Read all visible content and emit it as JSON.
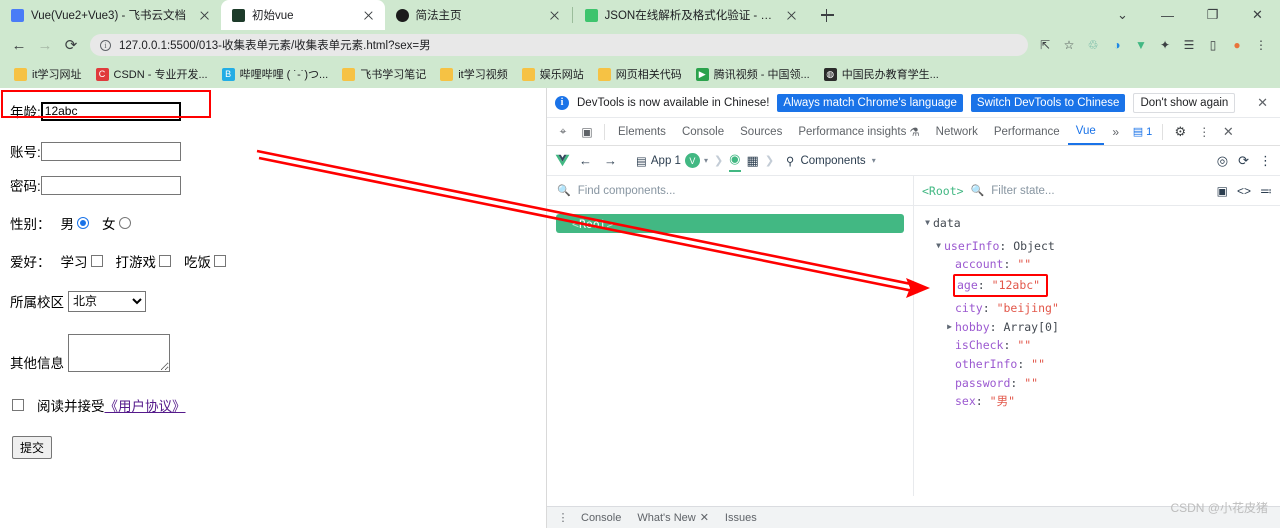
{
  "browser": {
    "tabs": [
      {
        "title": "Vue(Vue2+Vue3) - 飞书云文档",
        "favicon_color": "#4a7cf7",
        "active": false
      },
      {
        "title": "初始vue",
        "favicon_color": "#1d3b2a",
        "active": true
      },
      {
        "title": "简法主页",
        "favicon_color": "#1b1b1b",
        "active": false
      },
      {
        "title": "JSON在线解析及格式化验证 - JS",
        "favicon_color": "#3ec46d",
        "active": false
      }
    ],
    "new_tab_label": "+",
    "window_controls": [
      "⌄",
      "—",
      "❐",
      "✕"
    ],
    "nav": {
      "back": "←",
      "forward": "→",
      "reload": "⟳",
      "url": "127.0.0.1:5500/013-收集表单元素/收集表单元素.html?sex=男",
      "info_glyph": "i"
    },
    "toolbar_icons": [
      "share-icon",
      "bookmark-star-icon",
      "recycle-icon",
      "opera-icon",
      "vue-devtools-icon",
      "extensions-icon",
      "reading-list-icon",
      "sidepanel-icon",
      "profile-avatar-icon",
      "chrome-menu-icon"
    ],
    "bookmarks": [
      {
        "label": "it学习网址",
        "icon": "folder",
        "color": "#f6c244"
      },
      {
        "label": "CSDN - 专业开发...",
        "icon": "C",
        "color": "#e03a3c"
      },
      {
        "label": "哔哩哔哩 ( ˙-˙)つ...",
        "icon": "B",
        "color": "#23ade5"
      },
      {
        "label": "飞书学习笔记",
        "icon": "folder",
        "color": "#f6c244"
      },
      {
        "label": "it学习视频",
        "icon": "folder",
        "color": "#f6c244"
      },
      {
        "label": "娱乐网站",
        "icon": "folder",
        "color": "#f6c244"
      },
      {
        "label": "网页相关代码",
        "icon": "folder",
        "color": "#f6c244"
      },
      {
        "label": "腾讯视频 - 中国领...",
        "icon": "▶",
        "color": "#2ba24c"
      },
      {
        "label": "中国民办教育学生...",
        "icon": "◍",
        "color": "#2b2b2b"
      }
    ]
  },
  "form": {
    "age": {
      "label": "年龄:",
      "value": "12abc"
    },
    "account": {
      "label": "账号:",
      "value": "",
      "placeholder": ""
    },
    "password": {
      "label": "密码:",
      "value": "",
      "placeholder": ""
    },
    "sex": {
      "label": "性别：",
      "option_male": "男",
      "option_female": "女",
      "selected": "男"
    },
    "hobby": {
      "label": "爱好：",
      "options": [
        "学习",
        "打游戏",
        "吃饭"
      ],
      "checked": []
    },
    "city": {
      "label": "所属校区",
      "value": "北京"
    },
    "other": {
      "label": "其他信息",
      "value": ""
    },
    "agree": {
      "prefix": "阅读并接受",
      "link": "《用户协议》",
      "checked": false
    },
    "submit": {
      "label": "提交"
    }
  },
  "devtools": {
    "notice": {
      "message": "DevTools is now available in Chinese!",
      "btn_always": "Always match Chrome's language",
      "btn_switch": "Switch DevTools to Chinese",
      "btn_dismiss": "Don't show again",
      "close": "✕"
    },
    "tabs": [
      {
        "label": "Elements",
        "active": false
      },
      {
        "label": "Console",
        "active": false
      },
      {
        "label": "Sources",
        "active": false
      },
      {
        "label": "Performance insights",
        "active": false,
        "suffix": "⚗"
      },
      {
        "label": "Network",
        "active": false
      },
      {
        "label": "Performance",
        "active": false
      },
      {
        "label": "Vue",
        "active": true
      }
    ],
    "tabs_overflow": "»",
    "message_count": "1",
    "tab_icons": [
      "inspect-icon",
      "device-toolbar-icon",
      "settings-gear-icon",
      "more-kebab-icon",
      "close-icon"
    ],
    "vue_bar": {
      "app_label": "App 1",
      "components_label": "Components",
      "back": "←",
      "forward": "→",
      "right_icons": [
        "target-icon",
        "refresh-icon",
        "kebab-icon"
      ]
    },
    "components_panel": {
      "search_placeholder": "Find components...",
      "root_open": "<",
      "root_name": "Root",
      "root_close": ">"
    },
    "state_panel": {
      "root_label": "<Root>",
      "filter_placeholder": "Filter state...",
      "right_icons": [
        "inspect-dom-icon",
        "code-icon",
        "collapse-icon"
      ],
      "group_label": "data",
      "nodes": [
        {
          "indent": 1,
          "triangle": "▼",
          "key": "userInfo",
          "key_style": "prop",
          "value": "Object",
          "value_style": "type",
          "highlight": false
        },
        {
          "indent": 2,
          "triangle": "",
          "key": "account",
          "key_style": "prop",
          "value": "\"\"",
          "value_style": "str",
          "highlight": false
        },
        {
          "indent": 2,
          "triangle": "",
          "key": "age",
          "key_style": "prop",
          "value": "\"12abc\"",
          "value_style": "str",
          "highlight": true
        },
        {
          "indent": 2,
          "triangle": "",
          "key": "city",
          "key_style": "prop",
          "value": "\"beijing\"",
          "value_style": "str",
          "highlight": false
        },
        {
          "indent": 2,
          "triangle": "▶",
          "key": "hobby",
          "key_style": "prop",
          "value": "Array[0]",
          "value_style": "type",
          "highlight": false
        },
        {
          "indent": 2,
          "triangle": "",
          "key": "isCheck",
          "key_style": "prop",
          "value": "\"\"",
          "value_style": "str",
          "highlight": false
        },
        {
          "indent": 2,
          "triangle": "",
          "key": "otherInfo",
          "key_style": "prop",
          "value": "\"\"",
          "value_style": "str",
          "highlight": false
        },
        {
          "indent": 2,
          "triangle": "",
          "key": "password",
          "key_style": "prop",
          "value": "\"\"",
          "value_style": "str",
          "highlight": false
        },
        {
          "indent": 2,
          "triangle": "",
          "key": "sex",
          "key_style": "prop",
          "value": "\"男\"",
          "value_style": "str",
          "highlight": false
        }
      ]
    },
    "drawer": {
      "tabs": [
        "Console",
        "What's New",
        "Issues"
      ],
      "whats_new_close": "✕"
    }
  },
  "annotation": {
    "watermark": "CSDN @小花皮猪",
    "arrow_color": "#ff0000",
    "highlight_color": "#ff0000"
  }
}
